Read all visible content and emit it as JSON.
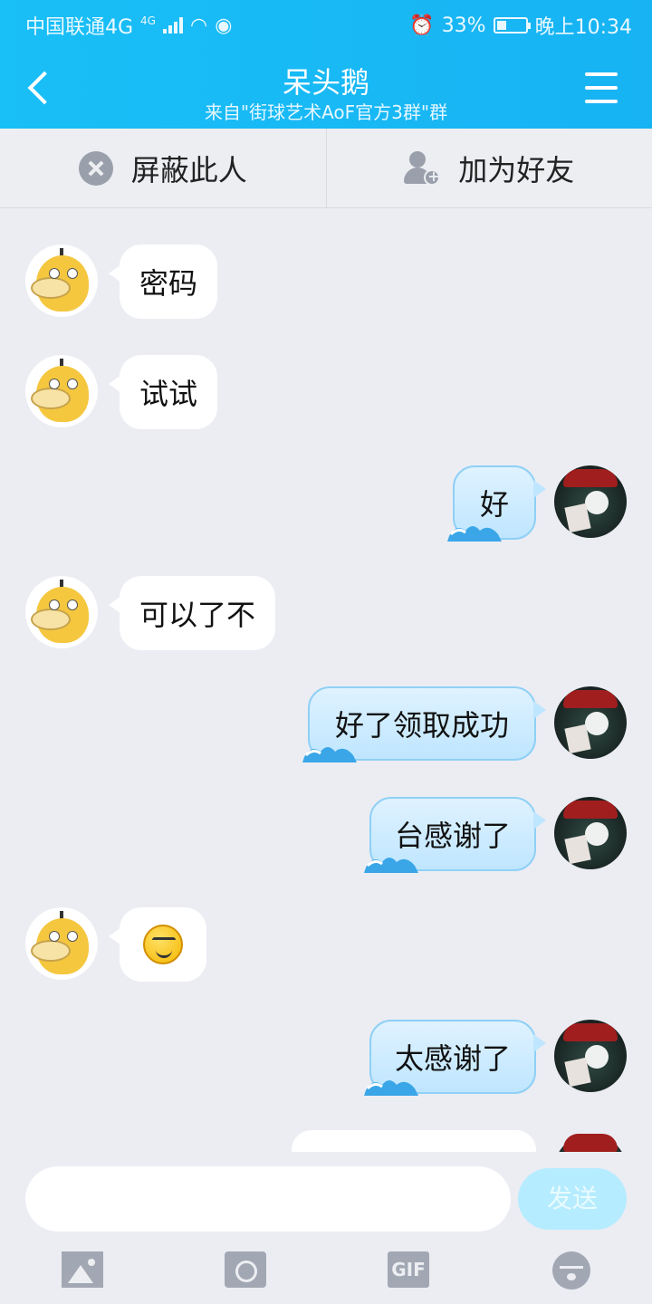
{
  "status_bar": {
    "carrier": "中国联通4G",
    "network_tag": "4G",
    "battery": "33%",
    "time": "晚上10:34"
  },
  "header": {
    "title": "呆头鹅",
    "subtitle": "来自\"街球艺术AoF官方3群\"群"
  },
  "actions": {
    "block_label": "屏蔽此人",
    "add_friend_label": "加为好友"
  },
  "messages": [
    {
      "from": "them",
      "text": "密码"
    },
    {
      "from": "them",
      "text": "试试"
    },
    {
      "from": "me",
      "text": "好"
    },
    {
      "from": "them",
      "text": "可以了不"
    },
    {
      "from": "me",
      "text": "好了领取成功"
    },
    {
      "from": "me",
      "text": "台感谢了"
    },
    {
      "from": "them",
      "icon": "smile-emoji-icon"
    },
    {
      "from": "me",
      "text": "太感谢了"
    }
  ],
  "input": {
    "value": "",
    "send_label": "发送"
  },
  "toolbar": {
    "gif_label": "GIF"
  }
}
